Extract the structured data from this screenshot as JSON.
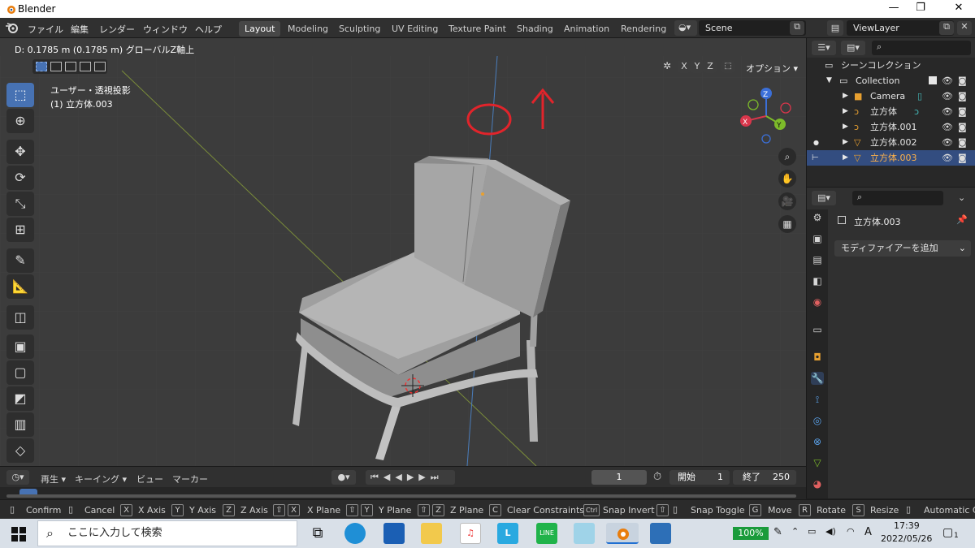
{
  "window": {
    "title": "Blender",
    "min": "—",
    "max": "❐",
    "close": "✕"
  },
  "menu": {
    "items": [
      "ファイル",
      "編集",
      "レンダー",
      "ウィンドウ",
      "ヘルプ"
    ]
  },
  "workspaces": {
    "tabs": [
      "Layout",
      "Modeling",
      "Sculpting",
      "UV Editing",
      "Texture Paint",
      "Shading",
      "Animation",
      "Rendering"
    ],
    "active": "Layout"
  },
  "scene": {
    "name": "Scene",
    "view_layer": "ViewLayer"
  },
  "viewport": {
    "header_text": "D: 0.1785 m (0.1785 m) グローバルZ軸上",
    "view_name": "ユーザー・透視投影",
    "object_name": "(1) 立方体.003",
    "axes": [
      "X",
      "Y",
      "Z"
    ],
    "options_label": "オプション",
    "gizmo": {
      "x": "X",
      "y": "Y",
      "z": "Z"
    },
    "annotation_color": "#e1242b"
  },
  "outliner": {
    "title": "シーンコレクション",
    "search_placeholder": "",
    "items": [
      {
        "name": "Collection"
      },
      {
        "name": "Camera"
      },
      {
        "name": "立方体"
      },
      {
        "name": "立方体.001"
      },
      {
        "name": "立方体.002"
      },
      {
        "name": "立方体.003"
      }
    ]
  },
  "properties": {
    "object_name": "立方体.003",
    "add_modifier": "モディファイアーを追加"
  },
  "timeline": {
    "playback": "再生",
    "keying": "キーイング",
    "view": "ビュー",
    "marker": "マーカー",
    "current_frame": "1",
    "start_label": "開始",
    "start": "1",
    "end_label": "終了",
    "end": "250"
  },
  "status": {
    "items": [
      {
        "key": "",
        "label": "Confirm"
      },
      {
        "key": "",
        "label": "Cancel"
      },
      {
        "key": "X",
        "label": "X Axis"
      },
      {
        "key": "Y",
        "label": "Y Axis"
      },
      {
        "key": "Z",
        "label": "Z Axis"
      },
      {
        "key": "X",
        "label": "X Plane"
      },
      {
        "key": "Y",
        "label": "Y Plane"
      },
      {
        "key": "Z",
        "label": "Z Plane"
      },
      {
        "key": "C",
        "label": "Clear Constraints"
      },
      {
        "key": "Ctrl",
        "label": "Snap Invert"
      },
      {
        "key": "",
        "label": "Snap Toggle"
      },
      {
        "key": "G",
        "label": "Move"
      },
      {
        "key": "R",
        "label": "Rotate"
      },
      {
        "key": "S",
        "label": "Resize"
      },
      {
        "key": "",
        "label": "Automatic C"
      }
    ]
  },
  "taskbar": {
    "search_placeholder": "ここに入力して検索",
    "battery": "100%",
    "ime": "A",
    "time": "17:39",
    "date": "2022/05/26",
    "notif": "1"
  }
}
